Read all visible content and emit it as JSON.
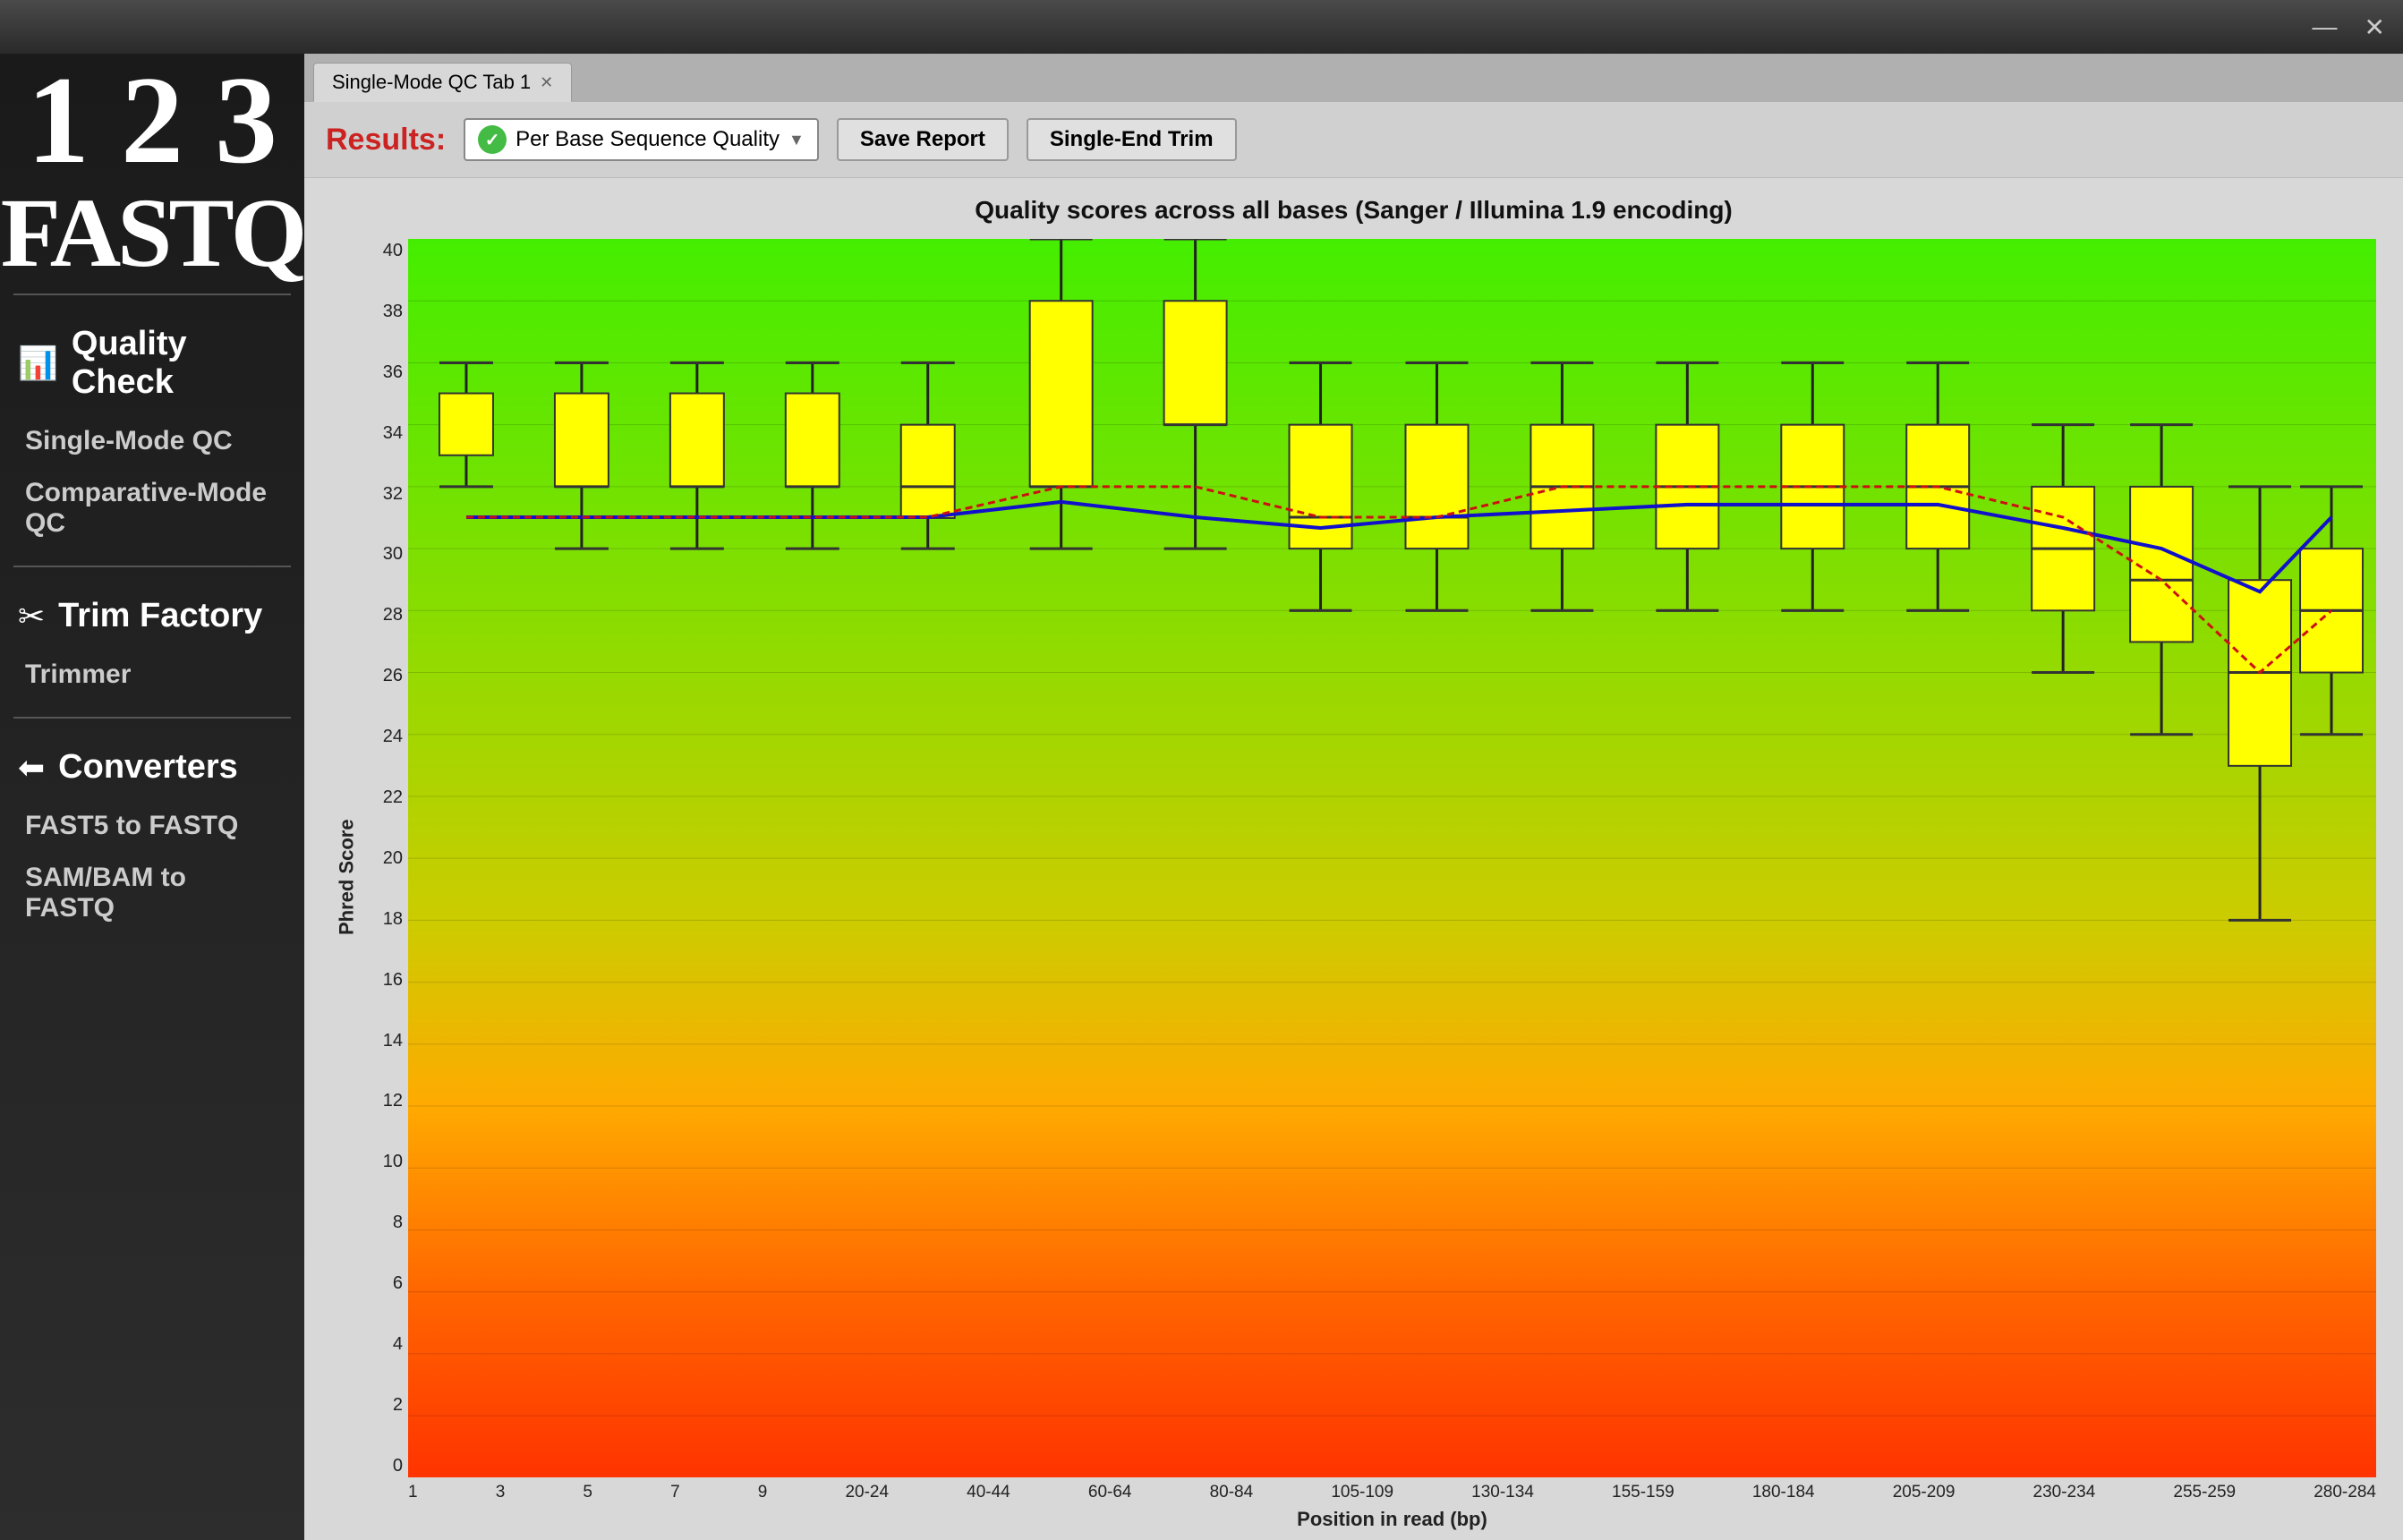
{
  "window": {
    "minimize_label": "—",
    "close_label": "✕"
  },
  "sidebar": {
    "logo_numbers": "1 2 3",
    "logo_fastq": "FASTQ",
    "sections": [
      {
        "id": "quality-check",
        "icon": "📊",
        "title": "Quality Check",
        "items": [
          {
            "id": "single-mode-qc",
            "label": "Single-Mode QC"
          },
          {
            "id": "comparative-mode-qc",
            "label": "Comparative-Mode QC"
          }
        ]
      },
      {
        "id": "trim-factory",
        "icon": "✂",
        "title": "Trim Factory",
        "items": [
          {
            "id": "trimmer",
            "label": "Trimmer"
          }
        ]
      },
      {
        "id": "converters",
        "icon": "⬅",
        "title": "Converters",
        "items": [
          {
            "id": "fast5-to-fastq",
            "label": "FAST5 to FASTQ"
          },
          {
            "id": "sam-bam-to-fastq",
            "label": "SAM/BAM to FASTQ"
          }
        ]
      }
    ]
  },
  "tabs": [
    {
      "id": "tab1",
      "label": "Single-Mode QC Tab 1",
      "active": true
    }
  ],
  "results_bar": {
    "label": "Results:",
    "dropdown_value": "Per Base Sequence Quality",
    "save_report_label": "Save Report",
    "single_end_trim_label": "Single-End Trim"
  },
  "chart": {
    "title": "Quality scores across all bases (Sanger / Illumina 1.9 encoding)",
    "y_axis_label": "Phred Score",
    "x_axis_label": "Position in read (bp)",
    "y_max": 40,
    "y_min": 0,
    "y_ticks": [
      40,
      38,
      36,
      34,
      32,
      30,
      28,
      26,
      24,
      22,
      20,
      18,
      16,
      14,
      12,
      10,
      8,
      6,
      4,
      2,
      0
    ],
    "x_labels": [
      "1",
      "3",
      "5",
      "7",
      "9",
      "20-24",
      "40-44",
      "60-64",
      "80-84",
      "105-109",
      "130-134",
      "155-159",
      "180-184",
      "205-209",
      "230-234",
      "255-259",
      "280-284"
    ],
    "colors": {
      "green_zone": "#44dd00",
      "yellow_zone": "#dddd00",
      "orange_zone": "#ff8800",
      "red_zone": "#ff3300",
      "box_fill": "#ffff00",
      "box_stroke": "#333",
      "whisker": "#333",
      "median_line": "#ff0000",
      "mean_line": "#0000ff"
    }
  }
}
